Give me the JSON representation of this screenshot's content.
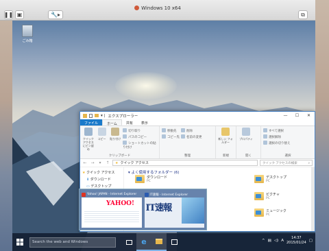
{
  "host": {
    "title": "Windows 10 x64",
    "toolbar": {
      "pause_icon": "pause-icon",
      "settings_icon": "wrench-icon"
    }
  },
  "desktop": {
    "icons": [
      {
        "label": "ごみ箱"
      }
    ]
  },
  "explorer": {
    "title": "エクスプローラー",
    "tabs": [
      "ファイル",
      "ホーム",
      "共有",
      "表示"
    ],
    "ribbon": {
      "clipboard": {
        "label": "クリップボード",
        "big": [
          "クイック アクセス にピン留め",
          "コピー",
          "貼り付け"
        ],
        "small": [
          "切り取り",
          "パスのコピー",
          "ショートカットの貼り付け"
        ]
      },
      "organize": {
        "label": "整理",
        "small": [
          "移動先",
          "コピー先",
          "削除",
          "名前の変更"
        ]
      },
      "new": {
        "label": "新規",
        "big": [
          "新しい フォルダー"
        ]
      },
      "open": {
        "label": "開く",
        "big": [
          "プロパティ"
        ]
      },
      "select": {
        "label": "選択",
        "small": [
          "すべて選択",
          "選択解除",
          "選択の切り替え"
        ]
      }
    },
    "address": "クイック アクセス",
    "search_placeholder": "クイック アクセスの検索",
    "nav": [
      "クイック アクセス",
      "ダウンロード",
      "デスクトップ"
    ],
    "section_header": "よく使用するフォルダー (6)",
    "folders": [
      {
        "name": "ダウンロード",
        "sub": "PC"
      },
      {
        "name": "デスクトップ",
        "sub": "PC"
      },
      {
        "name": "ピクチャ",
        "sub": "PC"
      },
      {
        "name": "ミュージック",
        "sub": "PC"
      }
    ]
  },
  "thumbnails": [
    {
      "title": "Yahoo! JAPAN - Internet Explorer",
      "logo": "YAHOO!"
    },
    {
      "title": "IT速報 - Internet Explorer",
      "logo": "IT速報"
    }
  ],
  "taskbar": {
    "search_placeholder": "Search the web and Windows",
    "clock_time": "14:37",
    "clock_date": "2015/01/24",
    "ime": "A"
  }
}
